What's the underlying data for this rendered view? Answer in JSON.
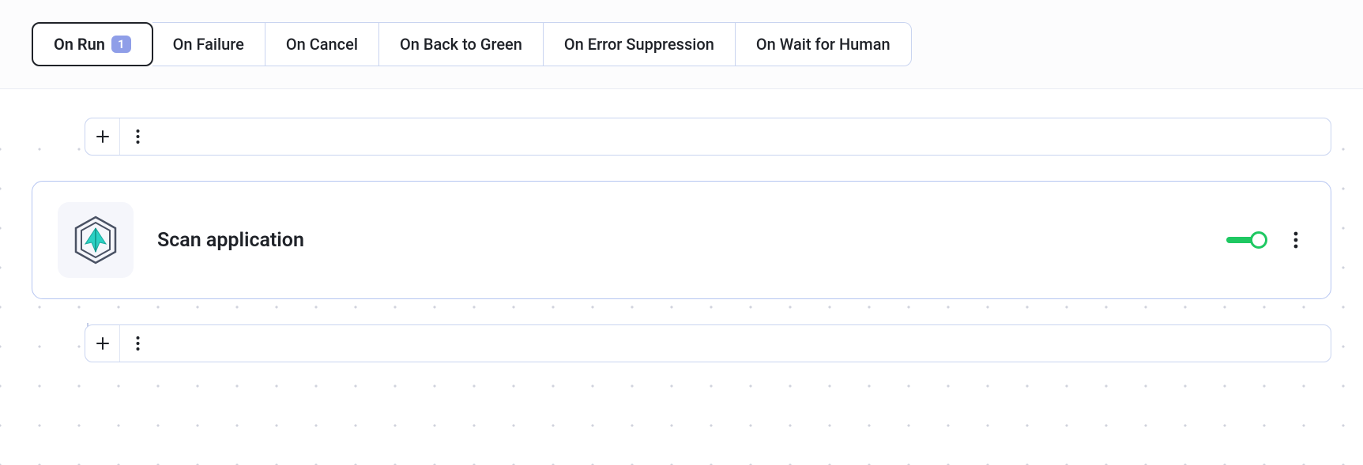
{
  "tabs": [
    {
      "label": "On Run",
      "badge": "1",
      "active": true
    },
    {
      "label": "On Failure",
      "badge": null,
      "active": false
    },
    {
      "label": "On Cancel",
      "badge": null,
      "active": false
    },
    {
      "label": "On Back to Green",
      "badge": null,
      "active": false
    },
    {
      "label": "On Error Suppression",
      "badge": null,
      "active": false
    },
    {
      "label": "On Wait for Human",
      "badge": null,
      "active": false
    }
  ],
  "step": {
    "title": "Scan application",
    "enabled": true,
    "icon": "phoenix-scanner-icon"
  },
  "colors": {
    "accent_border": "#b5c5f1",
    "tab_border": "#c9d4f0",
    "badge_bg": "#8f9ee8",
    "toggle_on": "#1ec862"
  }
}
